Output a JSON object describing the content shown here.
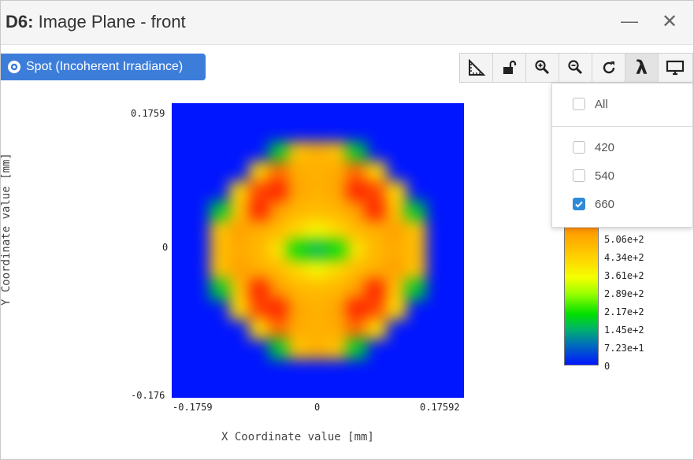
{
  "window": {
    "title_prefix": "D6:",
    "title_text": " Image Plane - front",
    "minimize_glyph": "—",
    "close_glyph": "✕"
  },
  "mode_button": {
    "label": "Spot (Incoherent Irradiance)",
    "icon": "gear-icon",
    "color": "#3d7dda"
  },
  "toolbar": {
    "buttons": [
      {
        "name": "ruler-icon"
      },
      {
        "name": "unlock-icon"
      },
      {
        "name": "zoom-in-icon"
      },
      {
        "name": "zoom-out-icon"
      },
      {
        "name": "refresh-icon"
      },
      {
        "name": "lambda-icon",
        "text": "λ"
      },
      {
        "name": "monitor-icon"
      }
    ]
  },
  "wavelength_menu": {
    "all_label": "All",
    "items": [
      {
        "label": "420",
        "checked": false
      },
      {
        "label": "540",
        "checked": false
      },
      {
        "label": "660",
        "checked": true
      }
    ]
  },
  "chart_data": {
    "type": "heatmap",
    "title": "",
    "xlabel": "X Coordinate value [mm]",
    "ylabel": "Y Coordinate value [mm]",
    "x_ticks": [
      "-0.1759",
      "0",
      "0.17592"
    ],
    "y_ticks": [
      "0.1759",
      "0",
      "-0.176"
    ],
    "xlim": [
      -0.1759,
      0.17592
    ],
    "ylim": [
      -0.176,
      0.1759
    ],
    "colorbar": {
      "labels": [
        "5.06e+2",
        "4.34e+2",
        "3.61e+2",
        "2.89e+2",
        "2.17e+2",
        "1.45e+2",
        "7.23e+1",
        "0"
      ],
      "max": 578,
      "min": 0
    },
    "grid_rows": 15,
    "grid_cols": 15,
    "irradiance": [
      [
        0,
        0,
        0,
        0,
        0,
        0,
        0,
        0,
        0,
        0,
        0,
        0,
        0,
        0,
        0
      ],
      [
        0,
        0,
        0,
        0,
        0,
        0,
        0,
        0,
        0,
        0,
        0,
        0,
        0,
        0,
        0
      ],
      [
        0,
        0,
        0,
        0,
        0,
        160,
        420,
        450,
        420,
        160,
        0,
        0,
        0,
        0,
        0
      ],
      [
        0,
        0,
        0,
        0,
        380,
        520,
        460,
        450,
        460,
        520,
        380,
        0,
        0,
        0,
        0
      ],
      [
        0,
        0,
        0,
        380,
        540,
        560,
        470,
        450,
        470,
        560,
        540,
        380,
        0,
        0,
        0
      ],
      [
        0,
        0,
        160,
        420,
        560,
        480,
        440,
        430,
        440,
        480,
        560,
        420,
        160,
        0,
        0
      ],
      [
        0,
        0,
        420,
        480,
        450,
        430,
        380,
        330,
        380,
        430,
        450,
        480,
        420,
        0,
        0
      ],
      [
        0,
        0,
        430,
        460,
        440,
        360,
        180,
        140,
        180,
        360,
        440,
        460,
        430,
        0,
        0
      ],
      [
        0,
        0,
        420,
        480,
        450,
        430,
        380,
        330,
        380,
        430,
        450,
        480,
        420,
        0,
        0
      ],
      [
        0,
        0,
        160,
        420,
        560,
        480,
        440,
        430,
        440,
        480,
        560,
        420,
        160,
        0,
        0
      ],
      [
        0,
        0,
        0,
        380,
        540,
        560,
        470,
        450,
        470,
        560,
        540,
        380,
        0,
        0,
        0
      ],
      [
        0,
        0,
        0,
        0,
        380,
        520,
        460,
        450,
        460,
        520,
        380,
        0,
        0,
        0,
        0
      ],
      [
        0,
        0,
        0,
        0,
        0,
        160,
        420,
        450,
        420,
        160,
        0,
        0,
        0,
        0,
        0
      ],
      [
        0,
        0,
        0,
        0,
        0,
        0,
        0,
        0,
        0,
        0,
        0,
        0,
        0,
        0,
        0
      ],
      [
        0,
        0,
        0,
        0,
        0,
        0,
        0,
        0,
        0,
        0,
        0,
        0,
        0,
        0,
        0
      ]
    ]
  }
}
